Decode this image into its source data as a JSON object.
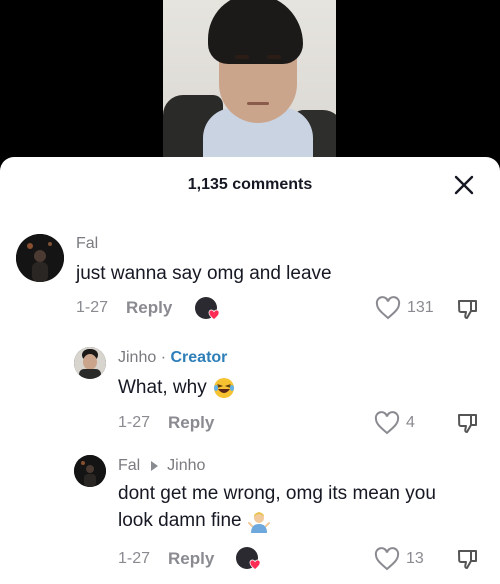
{
  "sheet": {
    "comment_count": "1,135 comments"
  },
  "comments": [
    {
      "author": "Fal",
      "text": "just wanna say omg and leave",
      "date": "1-27",
      "reply_label": "Reply",
      "likes": "131"
    },
    {
      "author": "Jinho",
      "separator": "·",
      "badge": "Creator",
      "text": "What, why",
      "date": "1-27",
      "reply_label": "Reply",
      "likes": "4"
    },
    {
      "author": "Fal",
      "reply_to": "Jinho",
      "text_line1": "dont get me wrong, omg its mean you",
      "text_line2": "look damn fine",
      "date": "1-27",
      "reply_label": "Reply",
      "likes": "13"
    }
  ],
  "colors": {
    "creator": "#2e7fb8",
    "heart": "#fe2c55",
    "muted": "#8a8b91",
    "text": "#161823"
  },
  "icons": [
    "close-icon",
    "heart-outline-icon",
    "dislike-icon",
    "heart-icon",
    "laughing-emoji",
    "shrug-emoji"
  ]
}
